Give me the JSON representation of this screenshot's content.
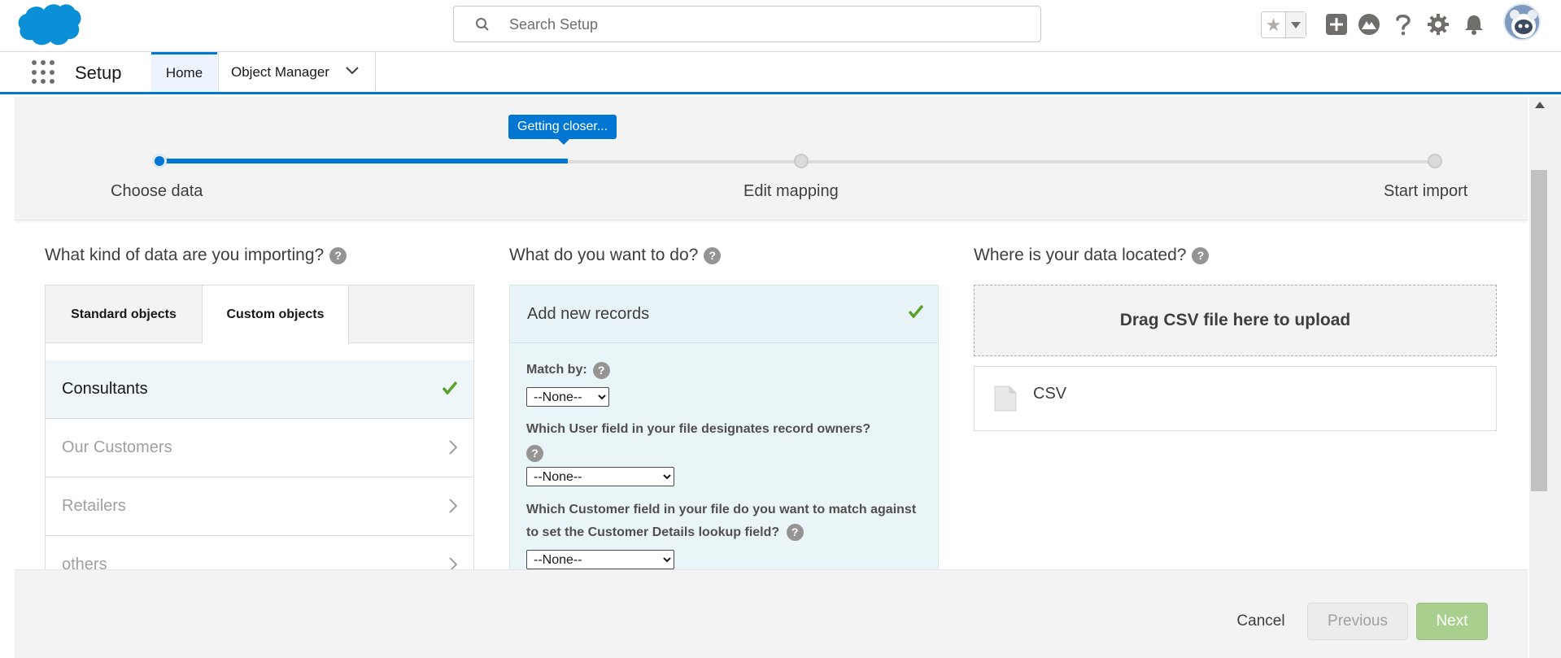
{
  "header": {
    "search_placeholder": "Search Setup",
    "icons": [
      "cloud-logo-icon",
      "search-icon",
      "star-icon",
      "chevron-down-icon",
      "add-icon",
      "trailhead-icon",
      "help-icon",
      "gear-icon",
      "bell-icon",
      "avatar"
    ]
  },
  "nav": {
    "app_name": "Setup",
    "tabs": [
      {
        "label": "Home"
      },
      {
        "label": "Object Manager"
      }
    ]
  },
  "progress": {
    "tooltip": "Getting closer...",
    "percent": 26,
    "steps": [
      {
        "label": "Choose data"
      },
      {
        "label": "Edit mapping"
      },
      {
        "label": "Start import"
      }
    ]
  },
  "columns": {
    "data_kind": {
      "title": "What kind of data are you importing?",
      "tabs": [
        {
          "label": "Standard objects"
        },
        {
          "label": "Custom objects"
        }
      ],
      "items": [
        {
          "label": "Consultants"
        },
        {
          "label": "Our Customers"
        },
        {
          "label": "Retailers"
        },
        {
          "label": "others"
        }
      ]
    },
    "action": {
      "title": "What do you want to do?",
      "option": "Add new records",
      "match_by_label": "Match by:",
      "match_by_value": "--None--",
      "owner_label": "Which User field in your file designates record owners?",
      "owner_value": "--None--",
      "customer_label": "Which Customer field in your file do you want to match against to set the Customer Details lookup field?",
      "customer_value": "--None--"
    },
    "location": {
      "title": "Where is your data located?",
      "drop_text": "Drag CSV file here to upload",
      "file_type": "CSV"
    }
  },
  "footer": {
    "cancel": "Cancel",
    "previous": "Previous",
    "next": "Next"
  },
  "colors": {
    "brand_blue": "#0176d3",
    "next_green": "#a8cf8d",
    "check_green": "#5ba22c"
  }
}
